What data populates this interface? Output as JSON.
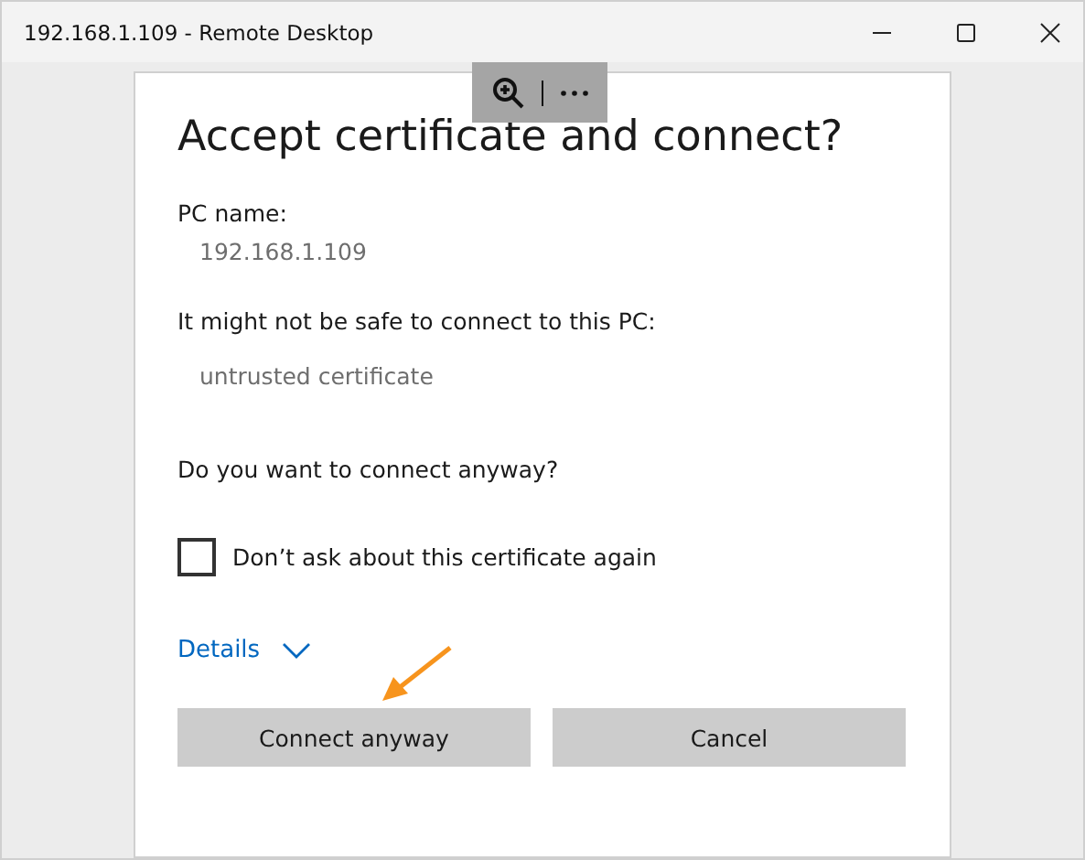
{
  "window": {
    "title": "192.168.1.109 - Remote Desktop"
  },
  "dialog": {
    "title": "Accept certificate and connect?",
    "fields": [
      {
        "label": "PC name:",
        "value": "192.168.1.109"
      },
      {
        "label": "It might not be safe to connect to this PC:",
        "value": "untrusted certificate"
      }
    ],
    "question": "Do you want to connect anyway?",
    "checkbox": {
      "label": "Don’t ask about this certificate again",
      "checked": false
    },
    "details": {
      "label": "Details",
      "expanded": false
    },
    "buttons": [
      "Connect anyway",
      "Cancel"
    ]
  }
}
